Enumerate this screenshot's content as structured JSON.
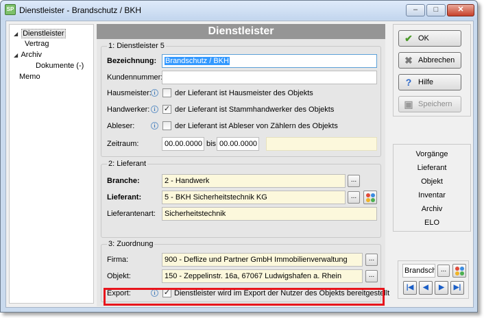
{
  "window": {
    "title": "Dienstleister - Brandschutz / BKH",
    "icon_text": "SP",
    "controls": {
      "min": "‒",
      "max": "□",
      "close": "✕"
    }
  },
  "tree": {
    "items": [
      {
        "label": "Dienstleister",
        "toggle": "◢"
      },
      {
        "label": "Vertrag",
        "toggle": ""
      },
      {
        "label": "Archiv",
        "toggle": "◢"
      },
      {
        "label": "Dokumente (-)",
        "toggle": ""
      },
      {
        "label": "Memo",
        "toggle": ""
      }
    ]
  },
  "main": {
    "header": "Dienstleister",
    "group1": {
      "title": "1: Dienstleister 5",
      "bezeichnung_label": "Bezeichnung:",
      "bezeichnung_value": "Brandschutz / BKH",
      "kundennummer_label": "Kundennummer:",
      "kundennummer_value": "",
      "hausmeister_label": "Hausmeister:",
      "hausmeister_checked": false,
      "hausmeister_text": "der Lieferant ist Hausmeister des Objekts",
      "handwerker_label": "Handwerker:",
      "handwerker_checked": true,
      "handwerker_text": "der Lieferant ist Stammhandwerker des Objekts",
      "ableser_label": "Ableser:",
      "ableser_checked": false,
      "ableser_text": "der Lieferant ist Ableser von Zählern des Objekts",
      "zeitraum_label": "Zeitraum:",
      "zeitraum_from": "00.00.0000",
      "zeitraum_bis": "bis",
      "zeitraum_to": "00.00.0000",
      "zeitraum_extra": ""
    },
    "group2": {
      "title": "2: Lieferant",
      "branche_label": "Branche:",
      "branche_value": "2 - Handwerk",
      "lieferant_label": "Lieferant:",
      "lieferant_value": "5 - BKH Sicherheitstechnik KG",
      "lieferantenart_label": "Lieferantenart:",
      "lieferantenart_value": "Sicherheitstechnik"
    },
    "group3": {
      "title": "3: Zuordnung",
      "firma_label": "Firma:",
      "firma_value": "900 - Deflize und Partner GmbH Immobilienverwaltung",
      "objekt_label": "Objekt:",
      "objekt_value": "150 - Zeppelinstr. 16a, 67067 Ludwigshafen a. Rhein",
      "export_label": "Export:",
      "export_checked": true,
      "export_text": "Dienstleister wird im Export der Nutzer des Objekts bereitgestellt"
    },
    "info_glyph": "i",
    "dots_glyph": "..."
  },
  "buttons": {
    "ok": "OK",
    "abbrechen": "Abbrechen",
    "hilfe": "Hilfe",
    "speichern": "Speichern"
  },
  "links": [
    "Vorgänge",
    "Lieferant",
    "Objekt",
    "Inventar",
    "Archiv",
    "ELO"
  ],
  "nav": {
    "record_value": "Brandschutz / BKH",
    "first": "|◀",
    "prev": "◀",
    "next": "▶",
    "last": "▶|"
  },
  "colors": {
    "header_bg": "#959595",
    "field_yellow": "#fcf8dc",
    "highlight_red": "#e8141c",
    "selection_blue": "#3399ff"
  }
}
